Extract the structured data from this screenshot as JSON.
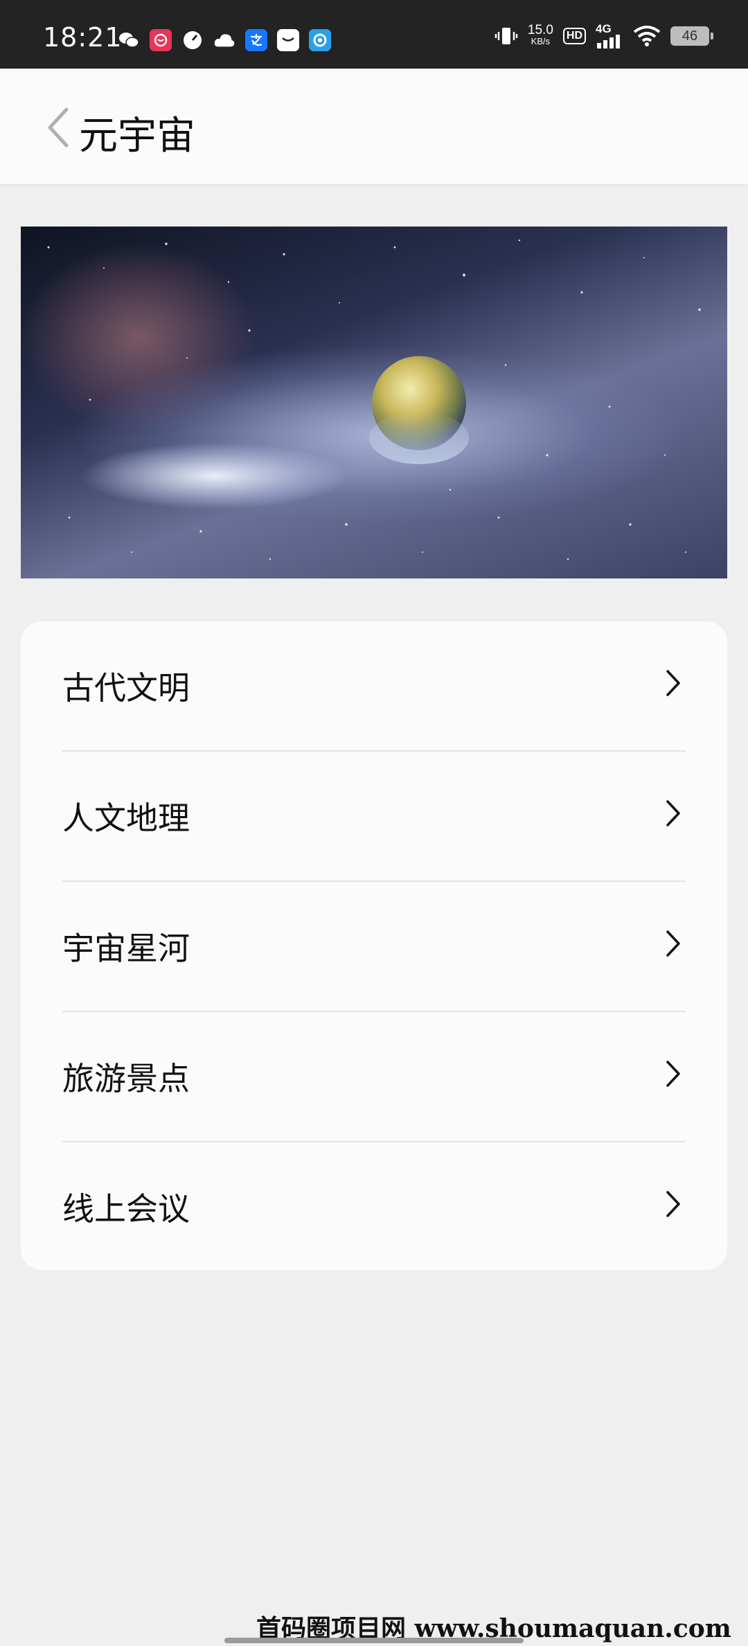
{
  "status_bar": {
    "time": "18:21",
    "net_speed_value": "15.0",
    "net_speed_unit": "KB/s",
    "hd_label": "HD",
    "signal_label": "4G",
    "battery_level": "46",
    "app_icons": [
      "wechat-icon",
      "red-app-icon",
      "speedometer-icon",
      "cloud-icon",
      "alipay-icon",
      "mail-icon",
      "browser-icon"
    ]
  },
  "nav": {
    "title": "元宇宙"
  },
  "menu": {
    "items": [
      {
        "label": "古代文明"
      },
      {
        "label": "人文地理"
      },
      {
        "label": "宇宙星河"
      },
      {
        "label": "旅游景点"
      },
      {
        "label": "线上会议"
      }
    ]
  },
  "watermark": "首码圈项目网 www.shoumaquan.com",
  "colors": {
    "status_bar_bg": "#232323",
    "page_bg": "#efefef",
    "card_bg": "#fbfbfb",
    "alipay_blue": "#1677ff",
    "red_app": "#e8345a"
  }
}
